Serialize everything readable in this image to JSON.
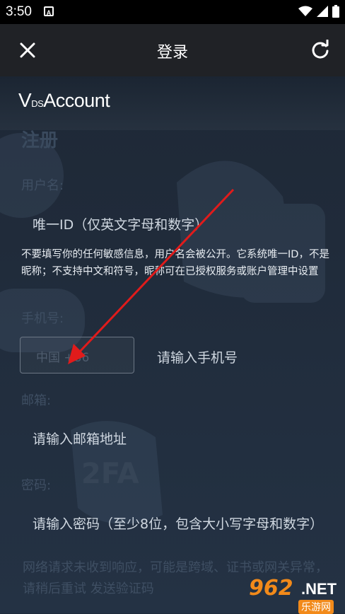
{
  "status_bar": {
    "time": "3:50",
    "notification_icon": "A"
  },
  "app_bar": {
    "title": "登录"
  },
  "logo": {
    "brand_prefix": "V",
    "brand_small": "DS",
    "brand_name": "Account"
  },
  "form": {
    "title": "注册",
    "username": {
      "label": "用户名:",
      "placeholder": "唯一ID（仅英文字母和数字）"
    },
    "hint": "不要填写你的任何敏感信息，用户名会被公开。它系统唯一ID，不是昵称；不支持中文和符号，昵称可在已授权服务或账户管理中设置",
    "phone": {
      "label": "手机号:",
      "country_value": "中国 +86",
      "placeholder": "请输入手机号"
    },
    "email": {
      "label": "邮箱:",
      "placeholder": "请输入邮箱地址"
    },
    "password": {
      "label": "密码:",
      "placeholder": "请输入密码（至少8位，包含大小写字母和数字）"
    },
    "network_error": "网络请求未收到响应，可能是跨域、证书或网关异常，请稍后重试",
    "send_code_link": "发送验证码"
  },
  "watermark": {
    "number": "962",
    "suffix": ".NET",
    "site": "乐游网"
  },
  "colors": {
    "arrow": "#e01b1b",
    "watermark_orange": "#f28a1a"
  }
}
